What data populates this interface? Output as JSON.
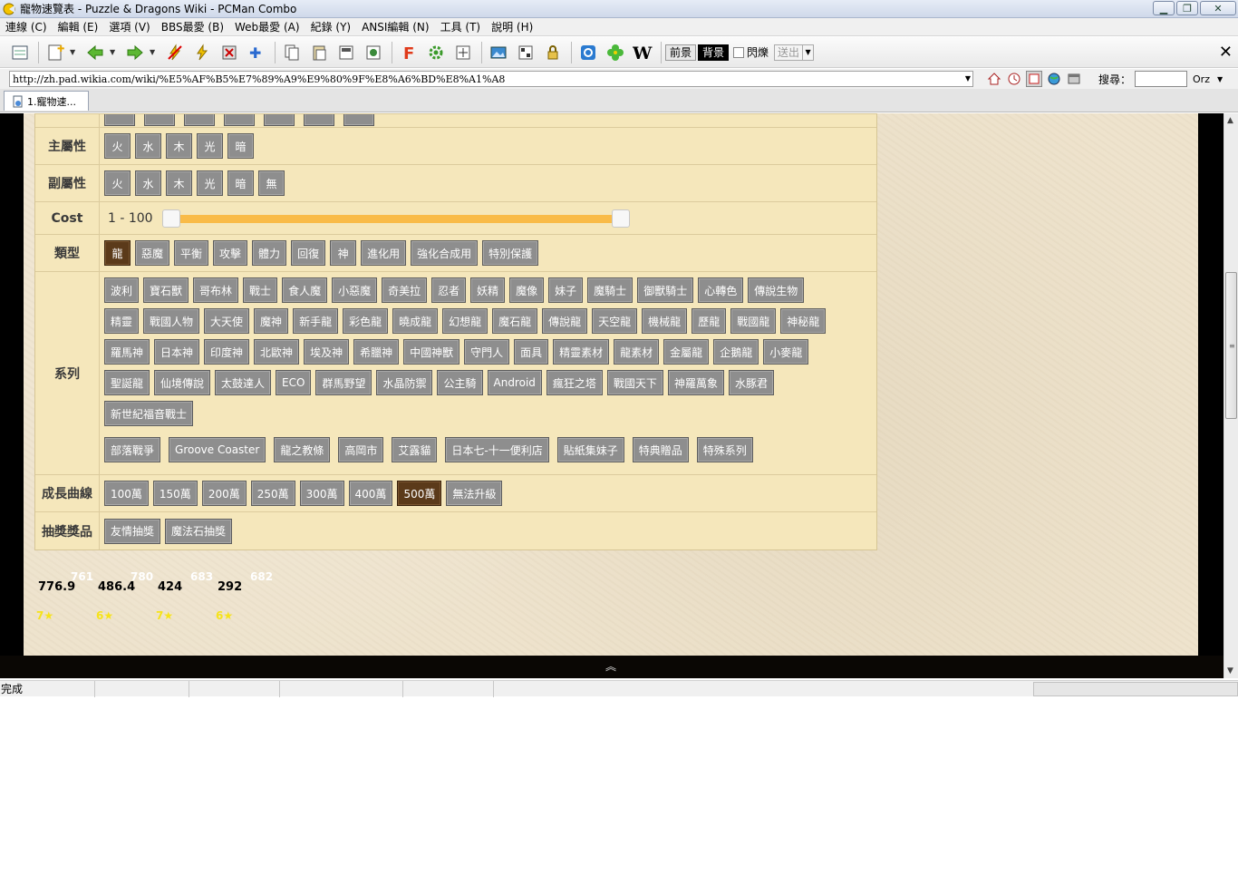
{
  "window": {
    "title": "寵物速覽表 - Puzzle & Dragons Wiki - PCMan Combo",
    "min_icon": "minimize-icon",
    "max_icon": "maximize-icon",
    "close_icon": "close-icon"
  },
  "menu": [
    "連線 (C)",
    "編輯 (E)",
    "選項 (V)",
    "BBS最愛 (B)",
    "Web最愛 (A)",
    "紀錄 (Y)",
    "ANSI編輯 (N)",
    "工具 (T)",
    "說明 (H)"
  ],
  "toolbar": {
    "front_label": "前景",
    "back_label": "背景",
    "blink_label": "閃爍",
    "send_label": "送出"
  },
  "address": {
    "url": "http://zh.pad.wikia.com/wiki/%E5%AF%B5%E7%89%A9%E9%80%9F%E8%A6%BD%E8%A1%A8",
    "search_label": "搜尋：",
    "engine": "Orz"
  },
  "tabs": [
    {
      "label": "1.寵物速..."
    }
  ],
  "filters": {
    "main_attr": {
      "label": "主屬性",
      "options": [
        "火",
        "水",
        "木",
        "光",
        "暗"
      ]
    },
    "sub_attr": {
      "label": "副屬性",
      "options": [
        "火",
        "水",
        "木",
        "光",
        "暗",
        "無"
      ]
    },
    "cost": {
      "label": "Cost",
      "range_text": "1 - 100",
      "min": 1,
      "max": 100,
      "low": 1,
      "high": 100
    },
    "type": {
      "label": "類型",
      "options": [
        "龍",
        "惡魔",
        "平衡",
        "攻擊",
        "體力",
        "回復",
        "神",
        "進化用",
        "強化合成用",
        "特別保護"
      ],
      "active": "龍"
    },
    "series": {
      "label": "系列",
      "rows": [
        [
          "波利",
          "寶石獸",
          "哥布林",
          "戰士",
          "食人魔",
          "小惡魔",
          "奇美拉",
          "忍者",
          "妖精",
          "魔像",
          "妹子",
          "魔騎士",
          "御獸騎士",
          "心轉色",
          "傳說生物"
        ],
        [
          "精靈",
          "戰國人物",
          "大天使",
          "魔神",
          "新手龍",
          "彩色龍",
          "曉成龍",
          "幻想龍",
          "魔石龍",
          "傳說龍",
          "天空龍",
          "機械龍",
          "歷龍",
          "戰國龍",
          "神秘龍"
        ],
        [
          "羅馬神",
          "日本神",
          "印度神",
          "北歐神",
          "埃及神",
          "希臘神",
          "中國神獸",
          "守門人",
          "面具",
          "精靈素材",
          "龍素材",
          "金屬龍",
          "企鵝龍",
          "小麥龍"
        ],
        [
          "聖誕龍",
          "仙境傳說",
          "太鼓達人",
          "ECO",
          "群馬野望",
          "水晶防禦",
          "公主騎",
          "Android",
          "瘋狂之塔",
          "戰國天下",
          "神羅萬象",
          "水豚君"
        ],
        [
          "新世紀福音戰士"
        ]
      ],
      "collab": [
        "部落戰爭",
        "Groove Coaster",
        "龍之教條",
        "高岡市",
        "艾露貓",
        "日本七-十一便利店",
        "貼紙集妹子",
        "特典贈品",
        "特殊系列"
      ]
    },
    "growth": {
      "label": "成長曲線",
      "options": [
        "100萬",
        "150萬",
        "200萬",
        "250萬",
        "300萬",
        "400萬",
        "500萬",
        "無法升級"
      ],
      "active": "500萬"
    },
    "gacha": {
      "label": "抽獎獎品",
      "options": [
        "友情抽獎",
        "魔法石抽獎"
      ]
    }
  },
  "stats": [
    {
      "value": "776.9",
      "sup": "761",
      "stars": "7★"
    },
    {
      "value": "486.4",
      "sup": "780",
      "stars": "6★"
    },
    {
      "value": "424",
      "sup": "683",
      "stars": "7★"
    },
    {
      "value": "292",
      "sup": "682",
      "stars": "6★"
    }
  ],
  "status": {
    "text": "完成"
  }
}
